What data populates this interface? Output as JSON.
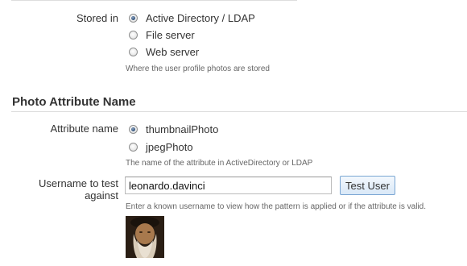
{
  "storage": {
    "label": "Stored in",
    "options": [
      {
        "label": "Active Directory / LDAP",
        "selected": true
      },
      {
        "label": "File server",
        "selected": false
      },
      {
        "label": "Web server",
        "selected": false
      }
    ],
    "help": "Where the user profile photos are stored"
  },
  "attribute_section": {
    "title": "Photo Attribute Name",
    "label": "Attribute name",
    "options": [
      {
        "label": "thumbnailPhoto",
        "selected": true
      },
      {
        "label": "jpegPhoto",
        "selected": false
      }
    ],
    "help": "The name of the attribute in ActiveDirectory or LDAP"
  },
  "test": {
    "label_line1": "Username to test",
    "label_line2": "against",
    "value": "leonardo.davinci",
    "button_label": "Test User",
    "help": "Enter a known username to view how the pattern is applied or if the attribute is valid."
  },
  "colors": {
    "accent": "#7aa6d3",
    "radio_selected": "#2f4f77"
  },
  "icons": {
    "radio_selected": "radio-selected-icon",
    "radio_unselected": "radio-unselected-icon",
    "photo": "user-photo"
  }
}
